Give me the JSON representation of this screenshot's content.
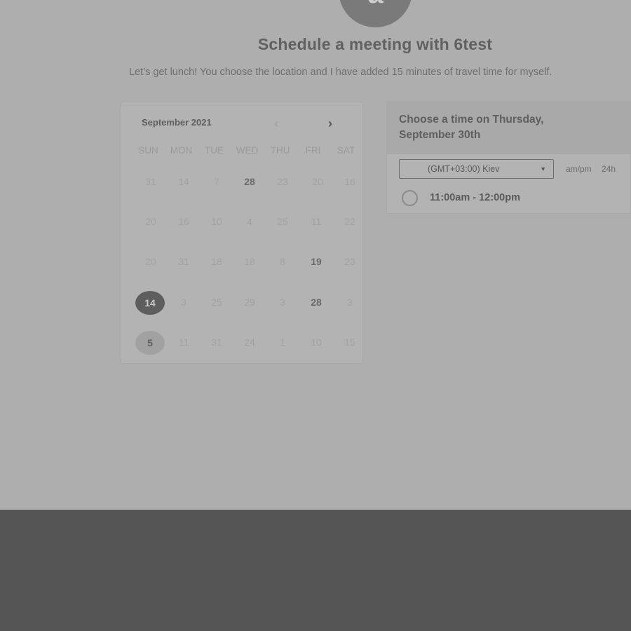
{
  "avatar": {
    "initial": "a"
  },
  "header": {
    "title": "Schedule a meeting with 6test",
    "description": "Let’s get lunch! You choose the location and I have added 15 minutes of travel time for myself."
  },
  "calendar": {
    "month_label": "September 2021",
    "prev_icon": "chevron-left-icon",
    "next_icon": "chevron-right-icon",
    "weekdays": [
      "SUN",
      "MON",
      "TUE",
      "WED",
      "THU",
      "FRI",
      "SAT"
    ],
    "weeks": [
      [
        "31",
        "14",
        "7",
        "28",
        "23",
        "20",
        "16"
      ],
      [
        "20",
        "16",
        "10",
        "4",
        "25",
        "11",
        "22"
      ],
      [
        "20",
        "31",
        "18",
        "18",
        "8",
        "19",
        "23"
      ],
      [
        "14",
        "3",
        "25",
        "29",
        "3",
        "28",
        "3"
      ],
      [
        "5",
        "11",
        "31",
        "24",
        "1",
        "10",
        "15"
      ]
    ],
    "selected_day": "14",
    "highlighted_day": "5"
  },
  "time_panel": {
    "heading": "Choose a time on Thursday, September 30th",
    "timezone": "(GMT+03:00) Kiev",
    "format_12h": "am/pm",
    "format_24h": "24h",
    "slots": [
      {
        "label": "11:00am - 12:00pm"
      }
    ]
  }
}
